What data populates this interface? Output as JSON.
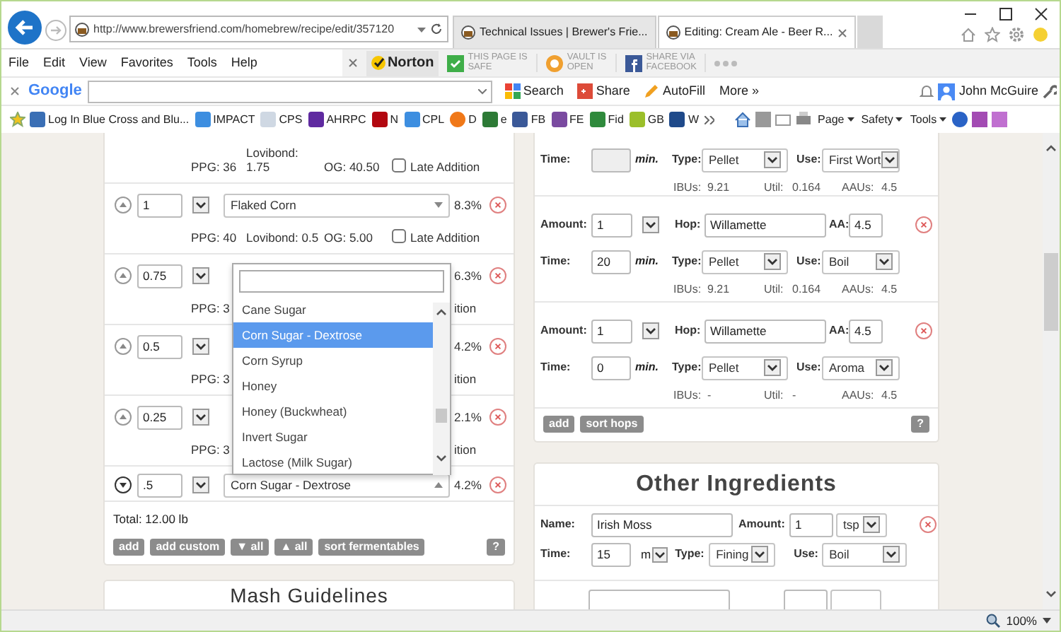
{
  "browser": {
    "address": "http://www.brewersfriend.com/homebrew/recipe/edit/357120",
    "tabs": [
      {
        "title": "Technical Issues | Brewer's Frie...",
        "selected": false
      },
      {
        "title": "Editing: Cream Ale - Beer R...",
        "selected": true
      }
    ]
  },
  "menu": [
    "File",
    "Edit",
    "View",
    "Favorites",
    "Tools",
    "Help"
  ],
  "security_bar": {
    "brand": "Norton",
    "badges": [
      {
        "kind": "check",
        "top": "THIS PAGE IS",
        "bottom": "SAFE"
      },
      {
        "kind": "vault",
        "top": "VAULT IS",
        "bottom": "OPEN"
      },
      {
        "kind": "facebook",
        "top": "SHARE VIA",
        "bottom": "FACEBOOK"
      }
    ]
  },
  "google_bar": {
    "logo": "Google",
    "buttons": [
      {
        "kind": "search",
        "label": "Search"
      },
      {
        "kind": "share",
        "label": "Share"
      },
      {
        "kind": "autofill",
        "label": "AutoFill"
      },
      {
        "kind": "more",
        "label": "More »"
      }
    ],
    "user": "John McGuire"
  },
  "favorites": [
    {
      "kind": "page",
      "label": "Log In Blue Cross and Blu..."
    },
    {
      "kind": "ie",
      "label": "IMPACT"
    },
    {
      "kind": "cps",
      "label": "CPS"
    },
    {
      "kind": "yahoo",
      "label": "AHRPC"
    },
    {
      "kind": "netflix",
      "label": "N"
    },
    {
      "kind": "ie",
      "label": "CPL"
    },
    {
      "kind": "dot",
      "label": "D"
    },
    {
      "kind": "bag",
      "label": "e"
    },
    {
      "kind": "facebook",
      "label": "FB"
    },
    {
      "kind": "fe",
      "label": "FE"
    },
    {
      "kind": "fid",
      "label": "Fid"
    },
    {
      "kind": "gb",
      "label": "GB"
    },
    {
      "kind": "w",
      "label": "W"
    }
  ],
  "command_bar": [
    "Page",
    "Safety",
    "Tools"
  ],
  "fermentables": {
    "rows": [
      {
        "ppg": "PPG: 36",
        "lovibond": "Lovibond: 1.75",
        "og": "OG: 40.50",
        "late_label": "Late Addition",
        "late_checked": false
      },
      {
        "arrow_down": false,
        "amount": "1",
        "name": "Flaked Corn",
        "open": false,
        "percent": "8.3%",
        "ppg": "PPG: 40",
        "lovibond": "Lovibond: 0.5",
        "og": "OG: 5.00",
        "late_label": "Late Addition",
        "late_checked": false
      },
      {
        "arrow_down": false,
        "amount": "0.75",
        "percent": "6.3%",
        "ppg": "PPG: 3",
        "late_tail": "ition"
      },
      {
        "arrow_down": false,
        "amount": "0.5",
        "percent": "4.2%",
        "ppg": "PPG: 3",
        "late_tail": "ition"
      },
      {
        "arrow_down": false,
        "amount": "0.25",
        "percent": "2.1%",
        "ppg": "PPG: 3",
        "late_tail": "ition"
      },
      {
        "arrow_down": true,
        "amount": ".5",
        "name": "Corn Sugar - Dextrose",
        "open": true,
        "percent": "4.2%"
      }
    ],
    "dropdown": {
      "options": [
        {
          "label": "Cane Sugar",
          "selected": false
        },
        {
          "label": "Corn Sugar - Dextrose",
          "selected": true
        },
        {
          "label": "Corn Syrup",
          "selected": false
        },
        {
          "label": "Honey",
          "selected": false
        },
        {
          "label": "Honey (Buckwheat)",
          "selected": false
        },
        {
          "label": "Invert Sugar",
          "selected": false
        },
        {
          "label": "Lactose (Milk Sugar)",
          "selected": false
        }
      ]
    },
    "total": "Total: 12.00 lb",
    "buttons": [
      "add",
      "add custom",
      "▼ all",
      "▲ all",
      "sort fermentables"
    ],
    "help": "?"
  },
  "mash": {
    "title": "Mash Guidelines"
  },
  "hops": {
    "rows": [
      {
        "time": {
          "label": "Time:",
          "unit": "min.",
          "disabled": true
        },
        "type": {
          "label": "Type:",
          "value": "Pellet"
        },
        "use": {
          "label": "Use:",
          "value": "First Wort"
        },
        "stats": [
          {
            "label": "IBUs:",
            "value": "9.21"
          },
          {
            "label": "Util:",
            "value": "0.164"
          },
          {
            "label": "AAUs:",
            "value": "4.5"
          }
        ]
      },
      {
        "amount": {
          "label": "Amount:",
          "value": "1"
        },
        "hop": {
          "label": "Hop:",
          "value": "Willamette"
        },
        "aa": {
          "label": "AA:",
          "value": "4.5"
        },
        "time": {
          "label": "Time:",
          "value": "20",
          "unit": "min.",
          "disabled": false
        },
        "type": {
          "label": "Type:",
          "value": "Pellet"
        },
        "use": {
          "label": "Use:",
          "value": "Boil"
        },
        "stats": [
          {
            "label": "IBUs:",
            "value": "9.21"
          },
          {
            "label": "Util:",
            "value": "0.164"
          },
          {
            "label": "AAUs:",
            "value": "4.5"
          }
        ]
      },
      {
        "amount": {
          "label": "Amount:",
          "value": "1"
        },
        "hop": {
          "label": "Hop:",
          "value": "Willamette"
        },
        "aa": {
          "label": "AA:",
          "value": "4.5"
        },
        "time": {
          "label": "Time:",
          "value": "0",
          "unit": "min.",
          "disabled": false
        },
        "type": {
          "label": "Type:",
          "value": "Pellet"
        },
        "use": {
          "label": "Use:",
          "value": "Aroma"
        },
        "stats": [
          {
            "label": "IBUs:",
            "value": "-"
          },
          {
            "label": "Util:",
            "value": "-"
          },
          {
            "label": "AAUs:",
            "value": "4.5"
          }
        ]
      }
    ],
    "buttons": [
      "add",
      "sort hops"
    ],
    "help": "?"
  },
  "other": {
    "title": "Other Ingredients",
    "rows": [
      {
        "name": {
          "label": "Name:",
          "value": "Irish Moss"
        },
        "amount": {
          "label": "Amount:",
          "value": "1",
          "unit": "tsp"
        },
        "time": {
          "label": "Time:",
          "value": "15",
          "unit": "m"
        },
        "type": {
          "label": "Type:",
          "value": "Fining"
        },
        "use": {
          "label": "Use:",
          "value": "Boil"
        }
      }
    ]
  },
  "status_bar": {
    "zoom": "100%"
  }
}
